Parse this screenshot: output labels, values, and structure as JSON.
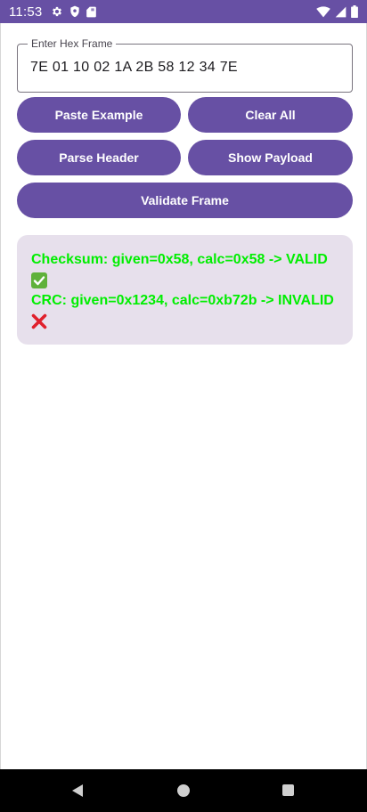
{
  "status_bar": {
    "time": "11:53",
    "left_icons": [
      "gear-icon",
      "shield-icon",
      "sd-card-icon"
    ],
    "right_icons": [
      "wifi-icon",
      "cellular-signal-icon",
      "battery-icon"
    ],
    "background_color": "#6750a4"
  },
  "input": {
    "label": "Enter Hex Frame",
    "value": "7E 01 10 02 1A 2B 58 12 34 7E"
  },
  "buttons": {
    "paste_example": "Paste Example",
    "clear_all": "Clear All",
    "parse_header": "Parse Header",
    "show_payload": "Show Payload",
    "validate_frame": "Validate Frame"
  },
  "result": {
    "checksum_line": "Checksum: given=0x58, calc=0x58 -> VALID",
    "checksum_glyph": "✅",
    "crc_line": "CRC: given=0x1234, calc=0xb72b -> INVALID",
    "crc_glyph": "❌",
    "text_color": "#00ee00",
    "card_color": "#e7e0ec"
  },
  "nav_bar": {
    "icons": [
      "back-icon",
      "home-icon",
      "recents-icon"
    ]
  },
  "colors": {
    "accent": "#6750a4",
    "button_text": "#ffffff"
  }
}
